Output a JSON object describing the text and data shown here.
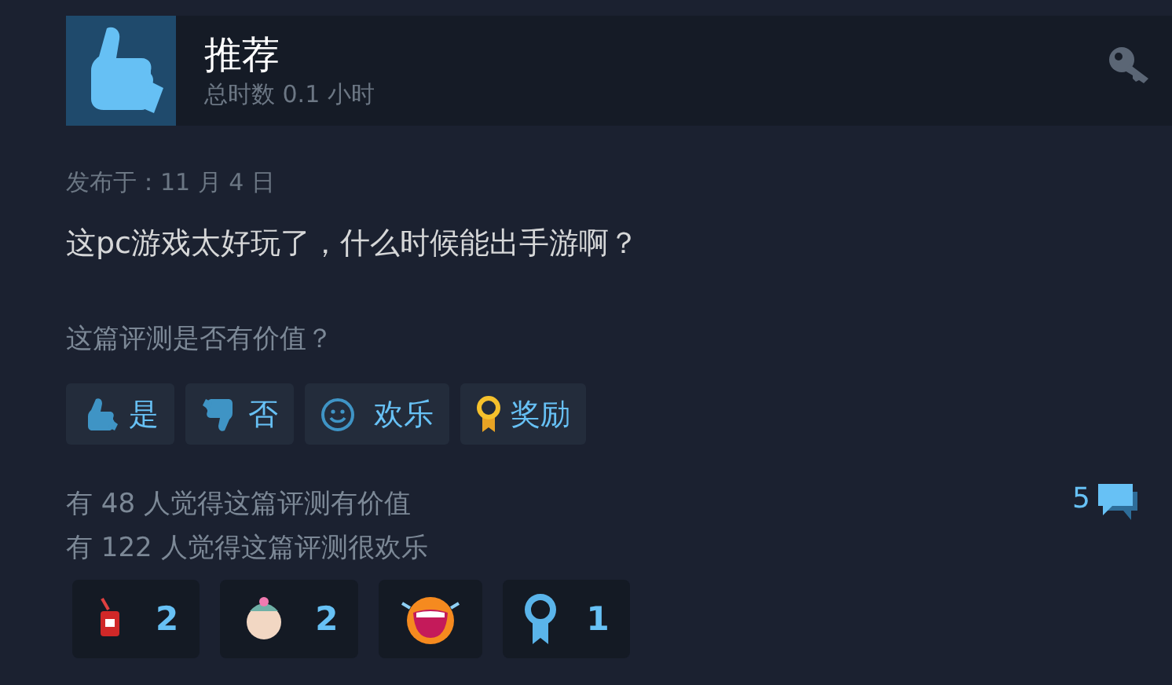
{
  "header": {
    "title": "推荐",
    "playtime": "总时数 0.1 小时"
  },
  "posted": "发布于：11 月 4 日",
  "review_text": "这pc游戏太好玩了，什么时候能出手游啊？",
  "helpful_prompt": "这篇评测是否有价值？",
  "vote_buttons": [
    {
      "kind": "yes",
      "label": "是"
    },
    {
      "kind": "no",
      "label": "否"
    },
    {
      "kind": "funny",
      "label": "欢乐"
    },
    {
      "kind": "award",
      "label": "奖励"
    }
  ],
  "stats": [
    "有 48 人觉得这篇评测有价值",
    "有 122 人觉得这篇评测很欢乐"
  ],
  "comments_count": "5",
  "awards": [
    {
      "kind": "can",
      "count": "2"
    },
    {
      "kind": "baby",
      "count": "2"
    },
    {
      "kind": "laugh"
    },
    {
      "kind": "ribbon",
      "count": "1"
    }
  ]
}
